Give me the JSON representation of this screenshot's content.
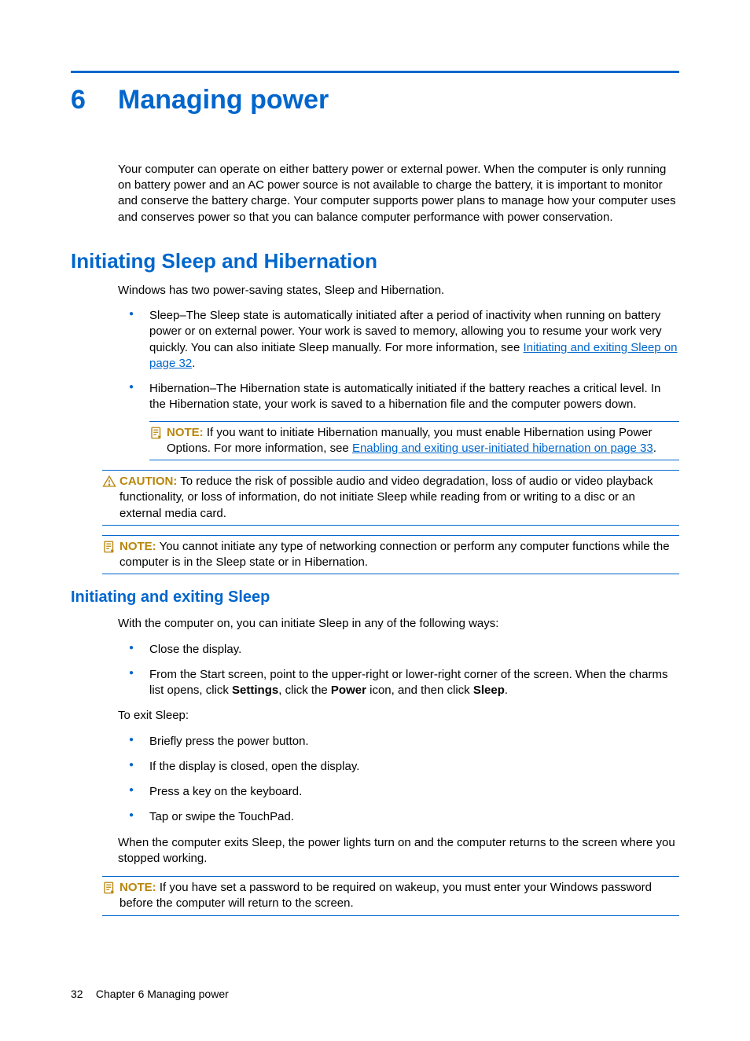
{
  "chapter_number": "6",
  "chapter_title": "Managing power",
  "intro": "Your computer can operate on either battery power or external power. When the computer is only running on battery power and an AC power source is not available to charge the battery, it is important to monitor and conserve the battery charge. Your computer supports power plans to manage how your computer uses and conserves power so that you can balance computer performance with power conservation.",
  "section1_title": "Initiating Sleep and Hibernation",
  "section1_intro": "Windows has two power-saving states, Sleep and Hibernation.",
  "sleep_bullet_pre": "Sleep–The Sleep state is automatically initiated after a period of inactivity when running on battery power or on external power. Your work is saved to memory, allowing you to resume your work very quickly. You can also initiate Sleep manually. For more information, see ",
  "sleep_link": "Initiating and exiting Sleep on page 32",
  "sleep_bullet_post": ".",
  "hibernation_bullet": "Hibernation–The Hibernation state is automatically initiated if the battery reaches a critical level. In the Hibernation state, your work is saved to a hibernation file and the computer powers down.",
  "note1_label": "NOTE:",
  "note1_pre": "If you want to initiate Hibernation manually, you must enable Hibernation using Power Options. For more information, see ",
  "note1_link": "Enabling and exiting user-initiated hibernation on page 33",
  "note1_post": ".",
  "caution_label": "CAUTION:",
  "caution_text": "To reduce the risk of possible audio and video degradation, loss of audio or video playback functionality, or loss of information, do not initiate Sleep while reading from or writing to a disc or an external media card.",
  "note2_label": "NOTE:",
  "note2_text": "You cannot initiate any type of networking connection or perform any computer functions while the computer is in the Sleep state or in Hibernation.",
  "subsection_title": "Initiating and exiting Sleep",
  "subsection_intro": "With the computer on, you can initiate Sleep in any of the following ways:",
  "initiate_items": {
    "0": "Close the display.",
    "1_pre": "From the Start screen, point to the upper-right or lower-right corner of the screen. When the charms list opens, click ",
    "1_b1": "Settings",
    "1_mid1": ", click the ",
    "1_b2": "Power",
    "1_mid2": " icon, and then click ",
    "1_b3": "Sleep",
    "1_post": "."
  },
  "exit_intro": "To exit Sleep:",
  "exit_items": {
    "0": "Briefly press the power button.",
    "1": "If the display is closed, open the display.",
    "2": "Press a key on the keyboard.",
    "3": "Tap or swipe the TouchPad."
  },
  "exit_result": "When the computer exits Sleep, the power lights turn on and the computer returns to the screen where you stopped working.",
  "note3_label": "NOTE:",
  "note3_text": "If you have set a password to be required on wakeup, you must enter your Windows password before the computer will return to the screen.",
  "footer_page": "32",
  "footer_text": "Chapter 6   Managing power"
}
